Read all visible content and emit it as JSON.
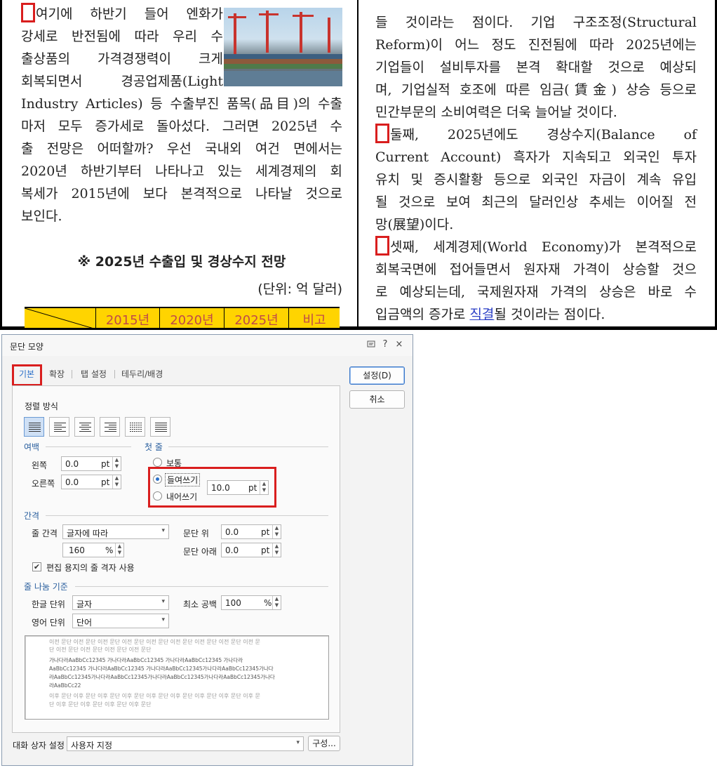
{
  "document": {
    "left_column": [
      "여기에 하반기 들어 엔화가",
      "강세로 반전됨에 따라 우리 수",
      "출상품의 가격경쟁력이 크게",
      "회복되면서 경공업제품(Light",
      "Industry Articles) 등 수출부진 품목(品目)의 수출",
      "마저 모두 증가세로 돌아섰다. 그러면 2025년 수",
      "출 전망은 어떠할까? 우선 국내외 여건 면에서는",
      "2020년 하반기부터 나타나고 있는 세계경제의 회",
      "복세가 2015년에 보다 본격적으로 나타날 것으로",
      "보인다."
    ],
    "table_title": "※ 2025년 수출입 및 경상수지 전망",
    "unit_label": "(단위: 억 달러)",
    "table_headers": [
      "2015년",
      "2020년",
      "2025년",
      "비고"
    ],
    "right_column": [
      "들 것이라는 점이다. 기업 구조조정(Structural",
      "Reform)이 어느 정도 진전됨에 따라 2025년에는",
      "기업들이 설비투자를 본격 확대할 것으로 예상되",
      "며, 기업실적 호조에 따른 임금(賃金) 상승 등으로",
      "민간부문의 소비여력은 더욱 늘어날 것이다.",
      "둘째, 2025년에도 경상수지(Balance of",
      "Current Account) 흑자가 지속되고 외국인 투자",
      "유치 및 증시활황 등으로 외국인 자금이 계속 유입",
      "될 것으로 보여 최근의 달러인상 추세는 이어질 전",
      "망(展望)이다.",
      "셋째, 세계경제(World Economy)가 본격적으로",
      "회복국면에 접어들면서 원자재 가격이 상승할 것으",
      "로 예상되는데, 국제원자재 가격의 상승은 바로 수"
    ],
    "last_line_before_link": "입금액의 증가로 ",
    "last_line_link": "직결",
    "last_line_after_link": "될 것이라는 점이다."
  },
  "dialog": {
    "title": "문단 모양",
    "titlebar_icons": [
      "chat-icon",
      "help-icon",
      "close-icon"
    ],
    "help_glyph": "?",
    "close_glyph": "×",
    "tabs": [
      "기본",
      "확장",
      "탭 설정",
      "테두리/배경"
    ],
    "active_tab": "기본",
    "buttons": {
      "ok": "설정(D)",
      "cancel": "취소",
      "configure": "구성..."
    },
    "align": {
      "label": "정렬 방식",
      "options": [
        "justify",
        "left",
        "center",
        "right",
        "distribute",
        "divide"
      ],
      "selected": "justify"
    },
    "margin": {
      "label": "여백",
      "left_label": "왼쪽",
      "left_value": "0.0",
      "right_label": "오른쪽",
      "right_value": "0.0",
      "unit": "pt"
    },
    "first_line": {
      "label": "첫 줄",
      "options": [
        "보통",
        "들여쓰기",
        "내어쓰기"
      ],
      "selected": "들여쓰기",
      "value": "10.0",
      "unit": "pt"
    },
    "spacing": {
      "label": "간격",
      "line_spacing_label": "줄 간격",
      "line_spacing_type": "글자에 따라",
      "line_spacing_value": "160",
      "line_spacing_unit": "%",
      "above_label": "문단 위",
      "above_value": "0.0",
      "below_label": "문단 아래",
      "below_value": "0.0",
      "unit": "pt",
      "grid_checkbox_label": "편집 용지의 줄 격자 사용",
      "grid_checked": true
    },
    "line_break": {
      "label": "줄 나눔 기준",
      "hangul_label": "한글 단위",
      "hangul_value": "글자",
      "english_label": "영어 단위",
      "english_value": "단어",
      "min_space_label": "최소 공백",
      "min_space_value": "100",
      "min_space_unit": "%"
    },
    "preview_lines": [
      "이전 문단 이전 문단 이전 문단 이전 문단 이전 문단 이전 문단 이전 문단 이전 문단 이전 문",
      "단 이전 문단 이전 문단 이전 문단 이전 문단",
      "  가나다라AaBbCc12345      가나다라AaBbCc12345      가나다라AaBbCc12345      가나다라",
      "AaBbCc12345    가나다라AaBbCc12345    가나다라AaBbCc12345가나다라AaBbCc12345가나다",
      "라AaBbCc12345가나다라AaBbCc12345가나다라AaBbCc12345가나다라AaBbCc12345가나다",
      "라AaBbCc22",
      "이후 문단 이후 문단 이후 문단 이후 문단 이후 문단 이후 문단 이후 문단 이후 문단 이후 문",
      "단 이후 문단 이후 문단 이후 문단 이후 문단"
    ],
    "dialog_setting_label": "대화 상자 설정",
    "dialog_setting_value": "사용자 지정"
  },
  "colors": {
    "highlight": "#d91e1e",
    "accent": "#2a6fc9",
    "table_header_bg": "#ffd400",
    "link": "#2b3fc6"
  }
}
